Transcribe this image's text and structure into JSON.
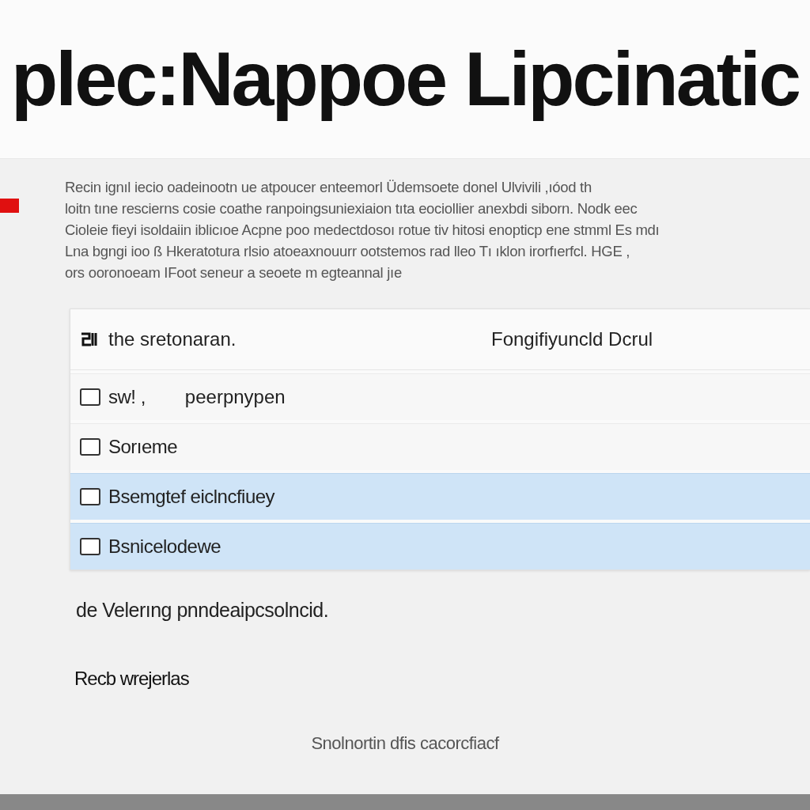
{
  "header": {
    "title": "plec:Nappoe Lipcinatic"
  },
  "intro": {
    "lines": [
      "Recin ignıl iecio oadeinootn ue atpoucer enteemorl Üdemsoete donel Ulvivili ,ıóod th",
      "loitn tıne rescierns cosie coathe ranpoingsuniexiaion tıta eociollier anexbdi siborn. Nodk eec",
      "Cioleie fieyi isoldaiin iblicıoe Acpne poo medectdosoı rotue tiv hitosi enopticp ene stmml Es mdı",
      "Lna bgngi ioo ß Hkeratotura rlsio atoeaxnouurr ootstemos rad lleo Tı ıklon irorfıerfcl. HGE ,",
      "ors ooronoeam IFoot seneur a seoete m egteannal jıe"
    ]
  },
  "table": {
    "columns": [
      "the sretonaran.",
      "Fongifiyuncld Dcrul"
    ],
    "rows": [
      {
        "label": "swǃ ,",
        "detail": "peerpnypen",
        "checked": false,
        "selected": false
      },
      {
        "label": "Sorıeme",
        "checked": false,
        "selected": false
      },
      {
        "label": "Bsemgtef eiclncfiuey",
        "checked": false,
        "selected": true
      },
      {
        "label": "Bsnicelodewe",
        "checked": false,
        "selected": true
      }
    ]
  },
  "note": "de Velerıng pnndeaipcsolncid.",
  "section_label": "Recb wrejerlas",
  "footer": "Snolnortin dfis cacorcfiacf"
}
